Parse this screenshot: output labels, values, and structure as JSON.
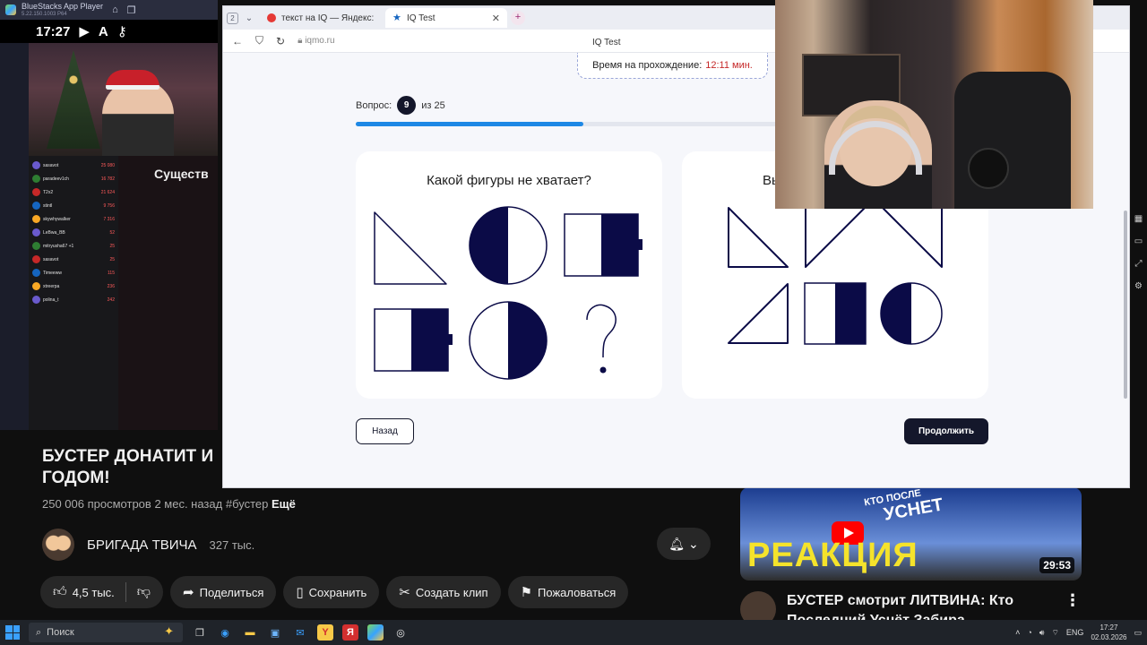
{
  "bluestacks": {
    "app_title": "BlueStacks App Player",
    "version": "5.22.150.1003 P64",
    "status_time": "17:27",
    "stream_overlay_text": "Существ"
  },
  "stream_chat": [
    {
      "name": "sasavot",
      "count": "25 080"
    },
    {
      "name": "paradeev1ch",
      "count": "16 782"
    },
    {
      "name": "T2x2",
      "count": "21 624"
    },
    {
      "name": "stintl",
      "count": "9 756"
    },
    {
      "name": "skywhywalker",
      "count": "7 316"
    },
    {
      "name": "LeBwa_BB",
      "count": "52"
    },
    {
      "name": "mitryusha67 +1",
      "count": "25"
    },
    {
      "name": "sasavot",
      "count": "25"
    },
    {
      "name": "Timeeww",
      "count": "115"
    },
    {
      "name": "xtreerpa",
      "count": "236"
    },
    {
      "name": "polina_t",
      "count": "242"
    }
  ],
  "youtube": {
    "video_title": "БУСТЕР ДОНАТИТ И ГОДОМ!",
    "views": "250 006 просмотров",
    "age": "2 мес. назад",
    "hashtag": "#бустер",
    "more": "Ещё",
    "channel_name": "БРИГАДА ТВИЧА",
    "subscribers": "327 тыс.",
    "likes": "4,5 тыс.",
    "share": "Поделиться",
    "save": "Сохранить",
    "clip": "Создать клип",
    "report": "Пожаловаться",
    "rec_overlay_small": "КТО ПОСЛЕ",
    "rec_overlay_mid": "УСНЕТ",
    "rec_overlay_big": "РЕАКЦИЯ",
    "rec_duration": "29:53",
    "rec_title": "БУСТЕР смотрит ЛИТВИНА: Кто Последний Уснёт Забира..."
  },
  "browser": {
    "tab_count": "2",
    "tabs": [
      {
        "label": "текст на IQ — Яндекс: нашлось"
      },
      {
        "label": "IQ Test"
      }
    ],
    "url": "iqmo.ru",
    "page_title": "IQ Test"
  },
  "iq_test": {
    "timer_label": "Время на прохождение:",
    "timer_value": "12:11 мин.",
    "question_label": "Вопрос:",
    "question_number": "9",
    "question_of": "из 25",
    "progress_fraction": 0.54,
    "question_text": "Какой фигуры не хватает?",
    "answers_title_partial": "Вы",
    "back_label": "Назад",
    "next_label": "Продолжить",
    "figure_color": "#0b0b47"
  },
  "taskbar": {
    "search_placeholder": "Поиск",
    "lang": "ENG",
    "time": "17:27",
    "date": "02.03.2026"
  }
}
